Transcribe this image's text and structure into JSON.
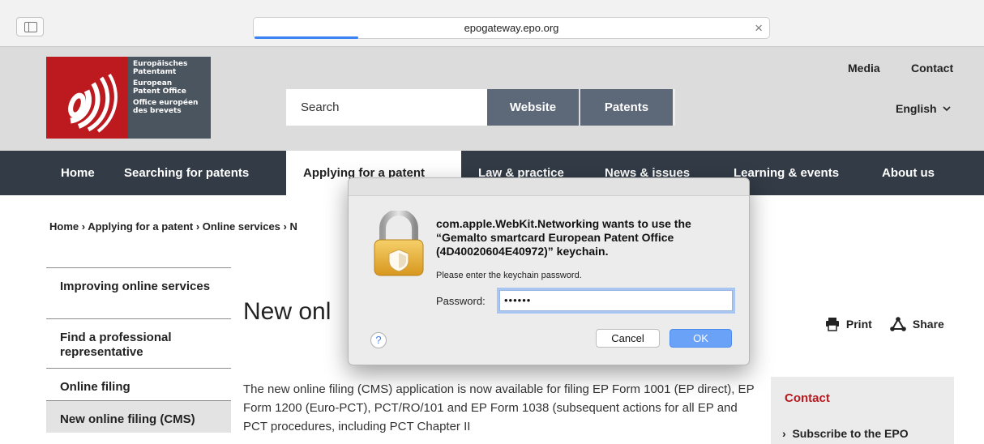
{
  "browser": {
    "url": "epogateway.epo.org",
    "sidebar_icon": "sidebar-icon",
    "close_icon": "close-icon"
  },
  "header": {
    "logo": {
      "line1": "Europäisches",
      "line2": "Patentamt",
      "line3": "European",
      "line4": "Patent Office",
      "line5": "Office européen",
      "line6": "des brevets"
    },
    "search_placeholder": "Search",
    "website_btn": "Website",
    "patents_btn": "Patents",
    "media": "Media",
    "contact": "Contact",
    "language": "English"
  },
  "nav": {
    "home": "Home",
    "searching": "Searching for patents",
    "applying": "Applying for a patent",
    "law": "Law & practice",
    "news": "News & issues",
    "learning": "Learning & events",
    "about": "About us"
  },
  "breadcrumb": {
    "home": "Home",
    "applying": "Applying for a patent",
    "online": "Online services",
    "partial": "N"
  },
  "sidenav": {
    "items": [
      {
        "label": "Improving online services"
      },
      {
        "label": "Find a professional representative"
      },
      {
        "label": "Online filing"
      },
      {
        "label": "New online filing (CMS)"
      }
    ]
  },
  "main": {
    "title": "New onl",
    "print": "Print",
    "share": "Share",
    "intro": "The new online filing (CMS) application is now available for filing EP Form 1001 (EP direct), EP Form 1200 (Euro-PCT), PCT/RO/101 and EP Form 1038 (subsequent actions for all EP and PCT procedures, including PCT Chapter II"
  },
  "contact_box": {
    "title": "Contact",
    "link": "Subscribe to the EPO"
  },
  "dialog": {
    "message": "com.apple.WebKit.Networking wants to use the “Gemalto smartcard European Patent Office (4D40020604E40972)” keychain.",
    "info": "Please enter the keychain password.",
    "password_label": "Password:",
    "password_value": "••••••",
    "help": "?",
    "cancel": "Cancel",
    "ok": "OK"
  },
  "colors": {
    "epo_red": "#bc1a1f",
    "nav_dark": "#323b46",
    "button_slate": "#5d6878",
    "ok_blue": "#6aa2f8"
  }
}
